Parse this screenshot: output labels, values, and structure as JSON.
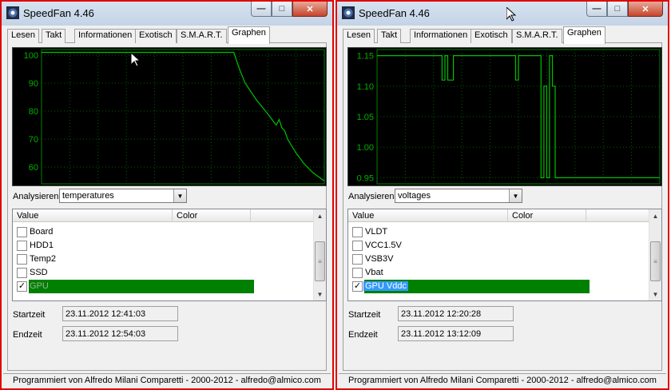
{
  "windows": [
    {
      "title": "SpeedFan 4.46",
      "tabs": [
        "Lesen",
        "Takt",
        "Informationen",
        "Exotisch",
        "S.M.A.R.T.",
        "Graphen"
      ],
      "active_tab": "Graphen",
      "analyse_label": "Analysieren",
      "analyse_value": "temperatures",
      "list_headers": [
        "Value",
        "Color"
      ],
      "list_items": [
        {
          "label": "Board",
          "checked": false
        },
        {
          "label": "HDD1",
          "checked": false
        },
        {
          "label": "Temp2",
          "checked": false
        },
        {
          "label": "SSD",
          "checked": false
        },
        {
          "label": "GPU",
          "checked": true,
          "selected": true
        }
      ],
      "start_label": "Startzeit",
      "start_value": "23.11.2012 12:41:03",
      "end_label": "Endzeit",
      "end_value": "23.11.2012 12:54:03",
      "status": "Programmiert von Alfredo Milani Comparetti - 2000-2012 - alfredo@almico.com"
    },
    {
      "title": "SpeedFan 4.46",
      "tabs": [
        "Lesen",
        "Takt",
        "Informationen",
        "Exotisch",
        "S.M.A.R.T.",
        "Graphen"
      ],
      "active_tab": "Graphen",
      "analyse_label": "Analysieren",
      "analyse_value": "voltages",
      "list_headers": [
        "Value",
        "Color"
      ],
      "list_items": [
        {
          "label": "VLDT",
          "checked": false
        },
        {
          "label": "VCC1.5V",
          "checked": false
        },
        {
          "label": "VSB3V",
          "checked": false
        },
        {
          "label": "Vbat",
          "checked": false
        },
        {
          "label": "GPU Vddc",
          "checked": true,
          "selected": true
        }
      ],
      "start_label": "Startzeit",
      "start_value": "23.11.2012 12:20:28",
      "end_label": "Endzeit",
      "end_value": "23.11.2012 13:12:09",
      "status": "Programmiert von Alfredo Milani Comparetti - 2000-2012 - alfredo@almico.com"
    }
  ],
  "chart_data": [
    {
      "type": "line",
      "ylim": [
        54,
        102
      ],
      "yticks": [
        "100",
        "90",
        "80",
        "70",
        "60"
      ],
      "ytick_values": [
        100,
        90,
        80,
        70,
        60
      ],
      "grid": true,
      "series": [
        {
          "color": "#00c000",
          "x": [
            0,
            0.05,
            0.1,
            0.2,
            0.3,
            0.4,
            0.5,
            0.6,
            0.68,
            0.7,
            0.72,
            0.76,
            0.8,
            0.83,
            0.84,
            0.85,
            0.86,
            0.87,
            0.9,
            0.93,
            0.96,
            1.0
          ],
          "y": [
            101,
            101,
            101,
            101,
            101,
            101,
            101,
            101,
            101,
            95,
            90,
            84,
            79,
            75,
            77,
            74,
            73,
            70,
            65,
            61,
            58,
            55
          ]
        }
      ]
    },
    {
      "type": "line",
      "ylim": [
        0.94,
        1.16
      ],
      "yticks": [
        "1.15",
        "1.10",
        "1.05",
        "1.00",
        "0.95"
      ],
      "ytick_values": [
        1.15,
        1.1,
        1.05,
        1.0,
        0.95
      ],
      "grid": true,
      "series": [
        {
          "color": "#00c000",
          "x": [
            0,
            0.23,
            0.23,
            0.24,
            0.24,
            0.25,
            0.25,
            0.27,
            0.27,
            0.28,
            0.28,
            0.49,
            0.49,
            0.5,
            0.5,
            0.58,
            0.58,
            0.59,
            0.59,
            0.6,
            0.6,
            0.61,
            0.61,
            0.62,
            0.62,
            0.63,
            0.63,
            1.0
          ],
          "y": [
            1.15,
            1.15,
            1.11,
            1.11,
            1.15,
            1.15,
            1.11,
            1.11,
            1.15,
            1.15,
            1.15,
            1.15,
            1.11,
            1.11,
            1.15,
            1.15,
            0.95,
            0.95,
            1.1,
            1.1,
            0.95,
            0.95,
            1.15,
            1.15,
            1.1,
            1.1,
            0.95,
            0.95
          ]
        }
      ]
    }
  ]
}
